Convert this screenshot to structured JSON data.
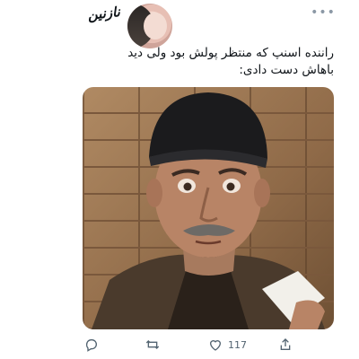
{
  "tweet": {
    "author": {
      "display_name": "نازنین"
    },
    "text": "راننده اسنپ که منتظر پولش بود ولی دید\nباهاش دست دادی:",
    "actions": {
      "like_count": "117"
    }
  },
  "icons": {
    "reply": "reply-bubble-icon",
    "retweet": "retweet-icon",
    "like": "heart-icon",
    "share": "share-icon",
    "more": "more-dots-icon"
  },
  "colors": {
    "text_primary": "#0f1419",
    "text_secondary": "#536471"
  }
}
